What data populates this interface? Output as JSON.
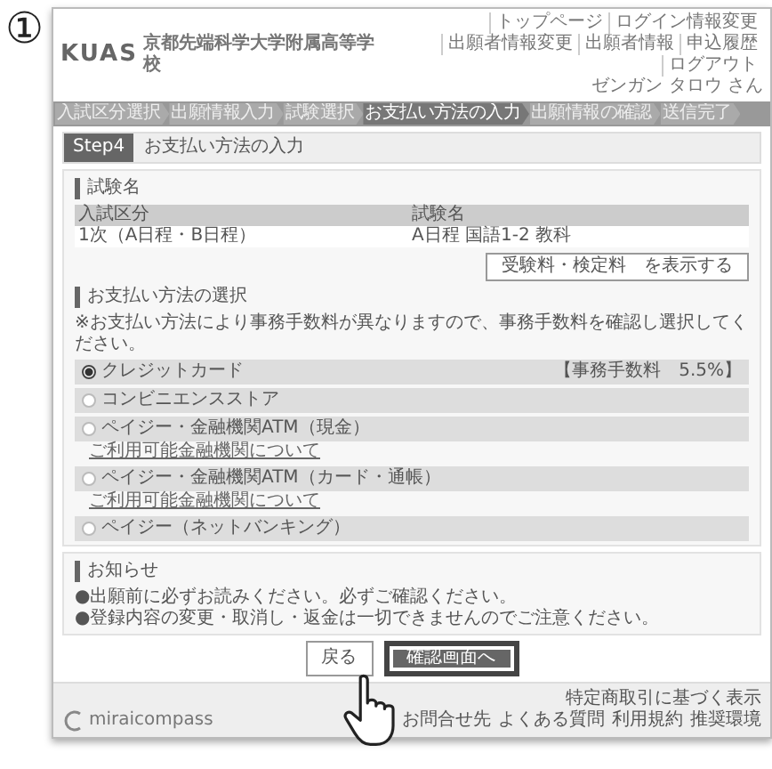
{
  "step_marker": "①",
  "header": {
    "logo": "KUAS",
    "school_name": "京都先端科学大学附属高等学校",
    "nav": [
      "トップページ",
      "ログイン情報変更",
      "出願者情報変更",
      "出願者情報",
      "申込履歴",
      "ログアウト"
    ],
    "user": "ゼンガン タロウ さん"
  },
  "steps": [
    {
      "label": "入試区分選択",
      "selected": false
    },
    {
      "label": "出願情報入力",
      "selected": false
    },
    {
      "label": "試験選択",
      "selected": false
    },
    {
      "label": "お支払い方法の入力",
      "selected": true
    },
    {
      "label": "出願情報の確認",
      "selected": false
    },
    {
      "label": "送信完了",
      "selected": false
    }
  ],
  "page_title": {
    "badge": "Step4",
    "title": "お支払い方法の入力"
  },
  "exam": {
    "heading": "試験名",
    "columns": [
      "入試区分",
      "試験名"
    ],
    "row": [
      "1次（A日程・B日程）",
      "A日程 国語1-2 教科"
    ],
    "button": "受験料・検定料　を表示する"
  },
  "payment": {
    "heading": "お支払い方法の選択",
    "note": "※お支払い方法により事務手数料が異なりますので、事務手数料を確認し選択してください。",
    "methods": [
      {
        "label": "クレジットカード",
        "selected": true,
        "fee": "【事務手数料　5.5%】"
      },
      {
        "label": "コンビニエンスストア",
        "selected": false
      },
      {
        "label": "ペイジー・金融機関ATM（現金）",
        "selected": false,
        "link": "ご利用可能金融機関について"
      },
      {
        "label": "ペイジー・金融機関ATM（カード・通帳）",
        "selected": false,
        "link": "ご利用可能金融機関について"
      },
      {
        "label": "ペイジー（ネットバンキング）",
        "selected": false
      }
    ]
  },
  "notice": {
    "heading": "お知らせ",
    "lines": [
      "●出願前に必ずお読みください。必ずご確認ください。",
      "●登録内容の変更・取消し・返金は一切できませんのでご注意ください。"
    ]
  },
  "buttons": [
    {
      "label": "戻る",
      "kind": "back",
      "highlighted": false
    },
    {
      "label": "確認画面へ",
      "kind": "primary",
      "highlighted": true
    }
  ],
  "footer": {
    "logo": "miraicompass",
    "note": "特定商取引に基づく表示",
    "links": [
      "お問合せ先",
      "よくある質問",
      "利用規約",
      "推奨環境"
    ]
  }
}
